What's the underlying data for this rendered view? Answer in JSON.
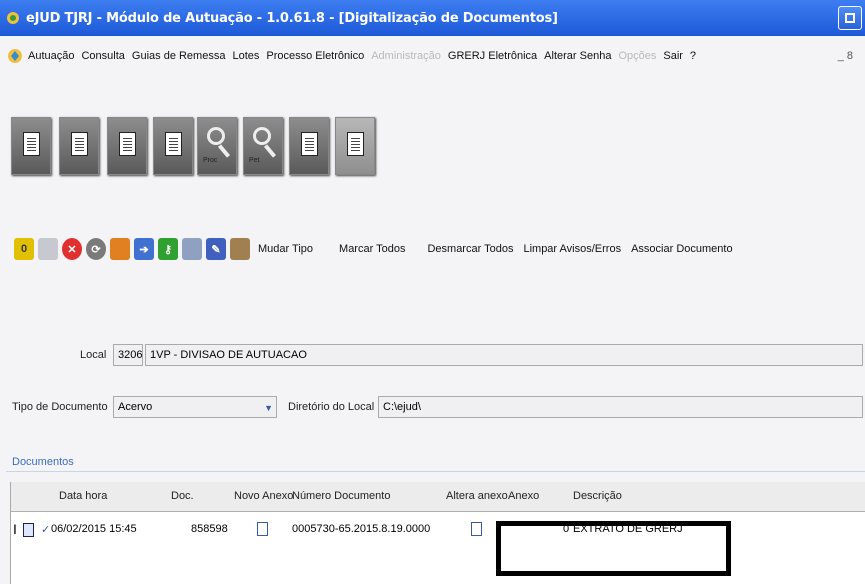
{
  "window": {
    "title": "eJUD TJRJ - Módulo de Autuação - 1.0.61.8 - [Digitalização de Documentos]"
  },
  "menu": {
    "items": [
      {
        "label": "Autuação",
        "enabled": true
      },
      {
        "label": "Consulta",
        "enabled": true
      },
      {
        "label": "Guias de Remessa",
        "enabled": true
      },
      {
        "label": "Lotes",
        "enabled": true
      },
      {
        "label": "Processo Eletrônico",
        "enabled": true
      },
      {
        "label": "Administração",
        "enabled": false
      },
      {
        "label": "GRERJ Eletrônica",
        "enabled": true
      },
      {
        "label": "Alterar Senha",
        "enabled": true
      },
      {
        "label": "Opções",
        "enabled": false
      },
      {
        "label": "Sair",
        "enabled": true
      },
      {
        "label": "?",
        "enabled": true
      }
    ],
    "min_label": "_ 8"
  },
  "big_toolbar": {
    "buttons": [
      {
        "name": "document",
        "caption": ""
      },
      {
        "name": "document-view",
        "caption": ""
      },
      {
        "name": "document-edit",
        "caption": ""
      },
      {
        "name": "scanner",
        "caption": ""
      },
      {
        "name": "search-proc",
        "caption": "Proc"
      },
      {
        "name": "search-pet",
        "caption": "Pet"
      },
      {
        "name": "attach-doc",
        "caption": ""
      },
      {
        "name": "scan-doc",
        "caption": ""
      }
    ]
  },
  "toolbar": {
    "icons": [
      {
        "name": "number-zero-icon",
        "glyph": "0",
        "color": "#e0c000"
      },
      {
        "name": "save-icon",
        "glyph": "",
        "color": "#c8c8d0"
      },
      {
        "name": "close-icon",
        "glyph": "✕",
        "color": "#e03030"
      },
      {
        "name": "refresh-icon",
        "glyph": "⟳",
        "color": "#7a7a7a"
      },
      {
        "name": "document-icon",
        "glyph": "",
        "color": "#e08020"
      },
      {
        "name": "arrow-icon",
        "glyph": "➔",
        "color": "#4070d0"
      },
      {
        "name": "key-icon",
        "glyph": "⚷",
        "color": "#30a030"
      },
      {
        "name": "printer-icon",
        "glyph": "",
        "color": "#8fa0c0"
      },
      {
        "name": "edit-icon",
        "glyph": "✎",
        "color": "#4060c0"
      },
      {
        "name": "eraser-icon",
        "glyph": "",
        "color": "#a08050"
      }
    ],
    "links": {
      "mudar_tipo": "Mudar Tipo",
      "marcar_todos": "Marcar Todos",
      "desmarcar_todos": "Desmarcar Todos",
      "limpar": "Limpar Avisos/Erros",
      "associar": "Associar Documento"
    }
  },
  "form": {
    "local_label": "Local",
    "local_code": "3206",
    "local_name": "1VP - DIVISAO DE AUTUACAO",
    "tipo_label": "Tipo de Documento",
    "tipo_value": "Acervo",
    "diretorio_label": "Diretório do Local",
    "diretorio_value": "C:\\ejud\\"
  },
  "documents": {
    "section_label": "Documentos",
    "columns": [
      "Data hora",
      "Doc.",
      "Novo Anexo",
      "Número Documento",
      "Altera anexo",
      "Anexo",
      "Descrição"
    ],
    "rows": [
      {
        "data_hora": "06/02/2015 15:45",
        "doc": "858598",
        "novo_anexo": false,
        "numero_documento": "0005730-65.2015.8.19.0000",
        "altera_anexo": false,
        "anexo": "0",
        "descricao": "EXTRATO DE GRERJ"
      }
    ]
  },
  "colors": {
    "titlebar": "#1d5ad8",
    "section_blue": "#3a6fc0"
  }
}
